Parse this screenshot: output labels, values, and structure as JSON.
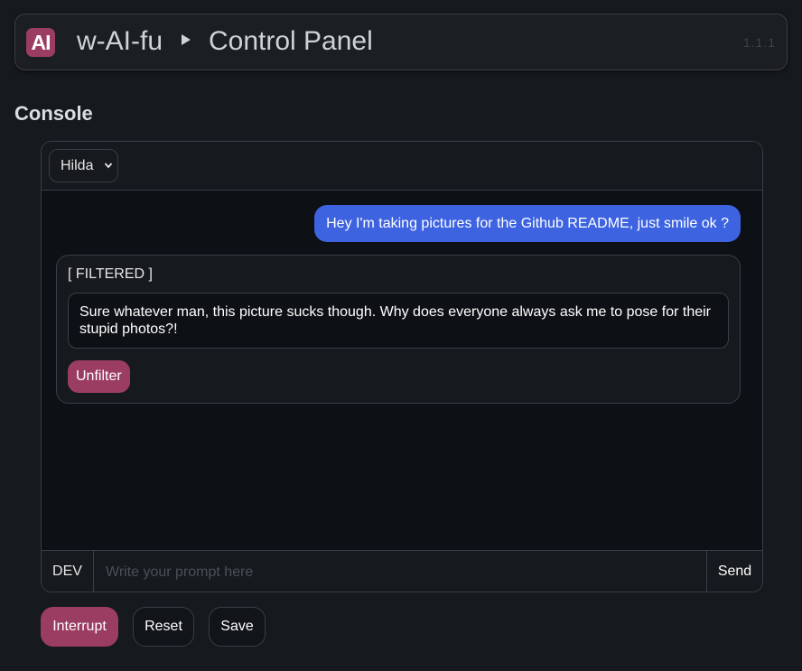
{
  "header": {
    "logo_text": "AI",
    "app_name": "w-AI-fu",
    "page_name": "Control Panel",
    "version": "1.1.1"
  },
  "console": {
    "title": "Console",
    "character_select": {
      "selected": "Hilda"
    },
    "messages": [
      {
        "role": "user",
        "text": "Hey I'm taking pictures for the Github README, just smile ok ?"
      },
      {
        "role": "assistant",
        "label": "[ FILTERED ]",
        "hidden_text": "Sure whatever man, this picture sucks though. Why does everyone always ask me to pose for their stupid photos?!",
        "unfilter_label": "Unfilter"
      }
    ],
    "input": {
      "mode_label": "DEV",
      "placeholder": "Write your prompt here",
      "value": "",
      "send_label": "Send"
    }
  },
  "actions": {
    "interrupt_label": "Interrupt",
    "reset_label": "Reset",
    "save_label": "Save"
  },
  "colors": {
    "accent": "#9b3d62",
    "user_bubble": "#3d63e0",
    "background": "#16191d"
  }
}
